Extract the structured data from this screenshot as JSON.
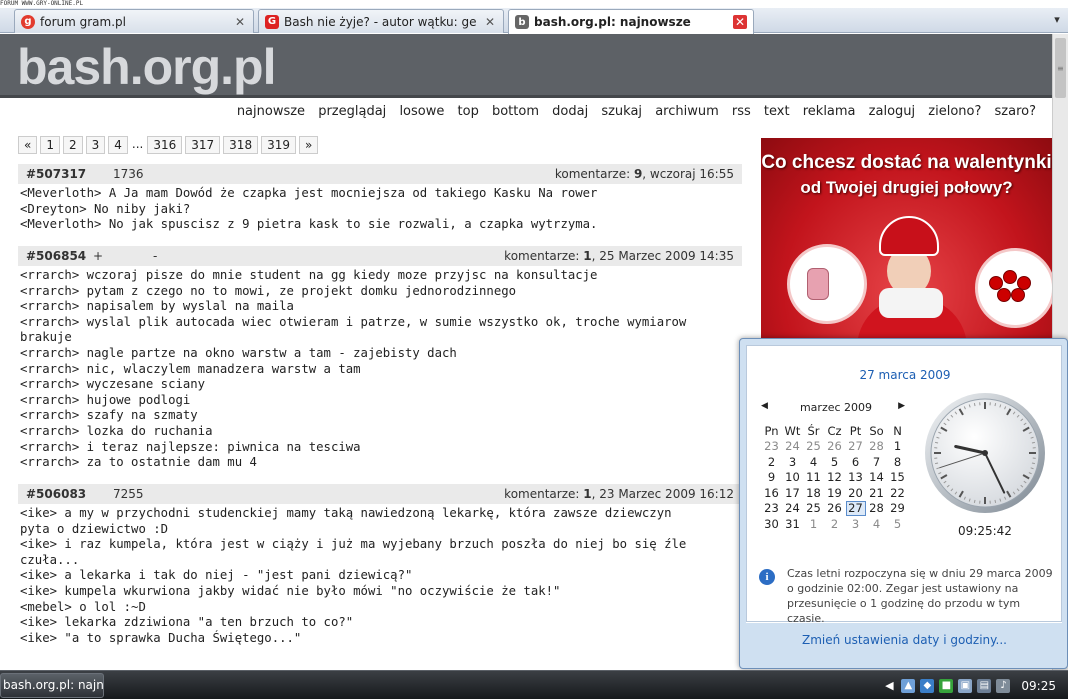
{
  "watermark": "FORUM WWW.GRY-ONLINE.PL",
  "tabs": [
    {
      "label": "forum gram.pl",
      "icon": "gram-favicon"
    },
    {
      "label": "Bash nie żyje? - autor wątku: gentz -...",
      "icon": "gram-favicon"
    },
    {
      "label": "bash.org.pl: najnowsze",
      "icon": "bash-favicon",
      "active": true
    }
  ],
  "site": {
    "logo": "bash.org.pl",
    "nav": [
      "najnowsze",
      "przeglądaj",
      "losowe",
      "top",
      "bottom",
      "dodaj",
      "szukaj",
      "archiwum",
      "rss",
      "text",
      "reklama",
      "zaloguj",
      "zielono?",
      "szaro?"
    ],
    "pager": [
      "«",
      "1",
      "2",
      "3",
      "4",
      "...",
      "316",
      "317",
      "318",
      "319",
      "»"
    ]
  },
  "quotes": [
    {
      "id": "#507317",
      "plus": "",
      "votes": "1736",
      "minus": "",
      "comments_label": "komentarze: ",
      "comments": "9",
      "date": ", wczoraj 16:55",
      "lines": [
        "<Meverloth> A Ja mam Dowód że czapka jest mocniejsza od takiego Kasku Na rower",
        "<Dreyton> No niby jaki?",
        "<Meverloth> No jak spuscisz z 9 pietra kask to sie rozwali, a czapka wytrzyma."
      ]
    },
    {
      "id": "#506854",
      "plus": "+",
      "votes": "",
      "minus": "-",
      "comments_label": "komentarze: ",
      "comments": "1",
      "date": ", 25 Marzec 2009 14:35",
      "lines": [
        "<rrarch> wczoraj pisze do mnie student na gg kiedy moze przyjsc na konsultacje",
        "<rrarch> pytam z czego no to mowi, ze projekt domku jednorodzinnego",
        "<rrarch> napisalem by wyslal na maila",
        "<rrarch> wyslal plik autocada wiec otwieram i patrze, w sumie wszystko ok, troche wymiarow",
        "brakuje",
        "<rrarch> nagle partze na okno warstw a tam - zajebisty dach",
        "<rrarch> nic, wlaczylem manadzera warstw a tam",
        "<rrarch> wyczesane sciany",
        "<rrarch> hujowe podlogi",
        "<rrarch> szafy na szmaty",
        "<rrarch> lozka do ruchania",
        "<rrarch> i teraz najlepsze: piwnica na tesciwa",
        "<rrarch> za to ostatnie dam mu 4"
      ]
    },
    {
      "id": "#506083",
      "plus": "",
      "votes": "7255",
      "minus": "",
      "comments_label": "komentarze: ",
      "comments": "1",
      "date": ", 23 Marzec 2009 16:12",
      "lines": [
        "<ike> a my w przychodni studenckiej mamy taką nawiedzoną lekarkę, która zawsze dziewczyn",
        "pyta o dziewictwo :D",
        "<ike> i raz kumpela, która jest w ciąży i już ma wyjebany brzuch poszła do niej bo się źle",
        "czuła...",
        "<ike> a lekarka i tak do niej - \"jest pani dziewicą?\"",
        "<ike> kumpela wkurwiona jakby widać nie było mówi \"no oczywiście że tak!\"",
        "<mebel> o lol :~D",
        "<ike> lekarka zdziwiona \"a ten brzuch to co?\"",
        "<ike> \"a to sprawka Ducha Świętego...\""
      ]
    }
  ],
  "ad": {
    "line1": "Co chcesz dostać na walentynki",
    "line2": "od Twojej drugiej połowy?"
  },
  "flyout": {
    "date_link": "27 marca 2009",
    "month": "marzec 2009",
    "weekdays": [
      "Pn",
      "Wt",
      "Śr",
      "Cz",
      "Pt",
      "So",
      "N"
    ],
    "weeks": [
      [
        [
          "23",
          "o"
        ],
        [
          "24",
          "o"
        ],
        [
          "25",
          "o"
        ],
        [
          "26",
          "o"
        ],
        [
          "27",
          "o"
        ],
        [
          "28",
          "o"
        ],
        [
          "1",
          ""
        ]
      ],
      [
        [
          "2",
          ""
        ],
        [
          "3",
          ""
        ],
        [
          "4",
          ""
        ],
        [
          "5",
          ""
        ],
        [
          "6",
          ""
        ],
        [
          "7",
          ""
        ],
        [
          "8",
          ""
        ]
      ],
      [
        [
          "9",
          ""
        ],
        [
          "10",
          ""
        ],
        [
          "11",
          ""
        ],
        [
          "12",
          ""
        ],
        [
          "13",
          ""
        ],
        [
          "14",
          ""
        ],
        [
          "15",
          ""
        ]
      ],
      [
        [
          "16",
          ""
        ],
        [
          "17",
          ""
        ],
        [
          "18",
          ""
        ],
        [
          "19",
          ""
        ],
        [
          "20",
          ""
        ],
        [
          "21",
          ""
        ],
        [
          "22",
          ""
        ]
      ],
      [
        [
          "23",
          ""
        ],
        [
          "24",
          ""
        ],
        [
          "25",
          ""
        ],
        [
          "26",
          ""
        ],
        [
          "27",
          "today"
        ],
        [
          "28",
          ""
        ],
        [
          "29",
          ""
        ]
      ],
      [
        [
          "30",
          ""
        ],
        [
          "31",
          ""
        ],
        [
          "1",
          "o"
        ],
        [
          "2",
          "o"
        ],
        [
          "3",
          "o"
        ],
        [
          "4",
          "o"
        ],
        [
          "5",
          "o"
        ]
      ]
    ],
    "time": "09:25:42",
    "clock": {
      "hours": 9,
      "minutes": 25,
      "seconds": 42
    },
    "dst_note": "Czas letni rozpoczyna się w dniu 29 marca 2009 o godzinie 02:00. Zegar jest ustawiony na przesunięcie o 1 godzinę do przodu w tym czasie.",
    "change_link": "Zmień ustawienia daty i godziny..."
  },
  "taskbar": {
    "window_button": "bash.org.pl: najnow...",
    "clock": "09:25"
  },
  "colors": {
    "header": "#5d6166",
    "link": "#1d5fb3",
    "ad_red": "#c2141c"
  }
}
